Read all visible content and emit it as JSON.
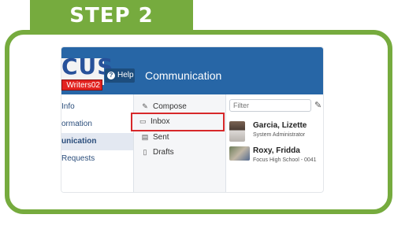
{
  "step_label": "STEP 2",
  "app": {
    "logo_text": "CUS",
    "user_badge": "Writers02",
    "help_label": "Help",
    "page_title": "Communication"
  },
  "left_nav": {
    "items": [
      {
        "label": "Info"
      },
      {
        "label": "ormation"
      },
      {
        "label": "unication",
        "active": true
      },
      {
        "label": "Requests"
      }
    ]
  },
  "comm_nav": {
    "compose": "Compose",
    "inbox": "Inbox",
    "sent": "Sent",
    "drafts": "Drafts"
  },
  "inbox": {
    "filter_placeholder": "Filter",
    "messages": [
      {
        "name": "Garcia, Lizette",
        "subtitle": "System Administrator"
      },
      {
        "name": "Roxy, Fridda",
        "subtitle": "Focus High School - 0041"
      }
    ]
  },
  "colors": {
    "step_green": "#76ab3e",
    "header_blue": "#2766a6",
    "highlight_red": "#d7282a"
  }
}
